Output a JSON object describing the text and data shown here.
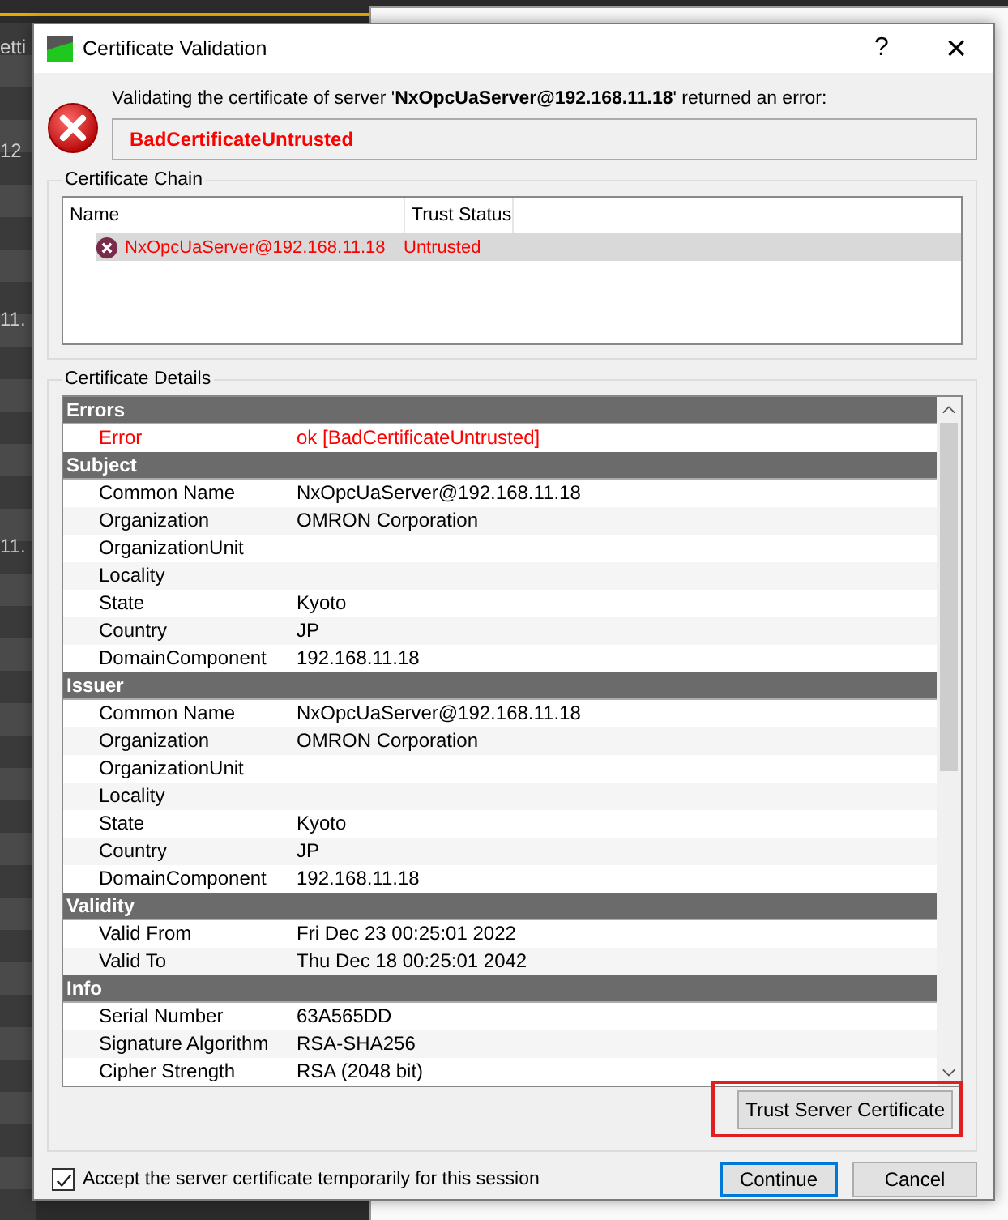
{
  "background": {
    "fragments": [
      "etti",
      "12",
      "11.",
      "11."
    ]
  },
  "window": {
    "title": "Certificate Validation",
    "help": "?",
    "close": "×"
  },
  "message": {
    "text": "Validating the certificate of server '**NxOpcUaServer@192.168.11.18**' returned an error:",
    "error": "BadCertificateUntrusted"
  },
  "chain": {
    "title": "Certificate Chain",
    "columns": [
      "Name",
      "Trust Status"
    ],
    "rows": [
      {
        "name": "NxOpcUaServer@192.168.11.18",
        "status": "Untrusted",
        "trusted": false,
        "selected": true
      }
    ]
  },
  "details": {
    "title": "Certificate Details",
    "sections": [
      {
        "title": "Errors",
        "rows": [
          {
            "label": "Error",
            "value": "ok [BadCertificateUntrusted]",
            "kind": "error"
          }
        ]
      },
      {
        "title": "Subject",
        "rows": [
          {
            "label": "Common Name",
            "value": "NxOpcUaServer@192.168.11.18",
            "kind": "normal"
          },
          {
            "label": "Organization",
            "value": "OMRON Corporation",
            "kind": "normal"
          },
          {
            "label": "OrganizationUnit",
            "kind": "normal"
          },
          {
            "label": "Locality",
            "kind": "normal"
          },
          {
            "label": "State",
            "value": "Kyoto",
            "kind": "normal"
          },
          {
            "label": "Country",
            "value": "JP",
            "kind": "normal"
          },
          {
            "label": "DomainComponent",
            "value": "192.168.11.18",
            "kind": "normal"
          }
        ]
      },
      {
        "title": "Issuer",
        "rows": [
          {
            "label": "Common Name",
            "value": "NxOpcUaServer@192.168.11.18",
            "kind": "normal"
          },
          {
            "label": "Organization",
            "value": "OMRON Corporation",
            "kind": "normal"
          },
          {
            "label": "OrganizationUnit",
            "kind": "normal"
          },
          {
            "label": "Locality",
            "kind": "normal"
          },
          {
            "label": "State",
            "value": "Kyoto",
            "kind": "normal"
          },
          {
            "label": "Country",
            "value": "JP",
            "kind": "normal"
          },
          {
            "label": "DomainComponent",
            "value": "192.168.11.18",
            "kind": "normal"
          }
        ]
      },
      {
        "title": "Validity",
        "rows": [
          {
            "label": "Valid From",
            "value": "Fri Dec 23 00:25:01 2022",
            "kind": "normal"
          },
          {
            "label": "Valid To",
            "value": "Thu Dec 18 00:25:01 2042",
            "kind": "normal"
          }
        ]
      },
      {
        "title": "Info",
        "rows": [
          {
            "label": "Serial Number",
            "value": "63A565DD",
            "kind": "normal"
          },
          {
            "label": "Signature Algorithm",
            "value": "RSA-SHA256",
            "kind": "normal"
          },
          {
            "label": "Cipher Strength",
            "value": "RSA (2048 bit)",
            "kind": "normal"
          }
        ]
      }
    ]
  },
  "trust_button": {
    "label": "Trust Server Certificate",
    "highlighted": true
  },
  "accept": {
    "label": "Accept the server certificate temporarily for this session",
    "checked": true
  },
  "buttons": [
    {
      "label": "Continue",
      "default": true
    },
    {
      "label": "Cancel",
      "default": false
    }
  ]
}
